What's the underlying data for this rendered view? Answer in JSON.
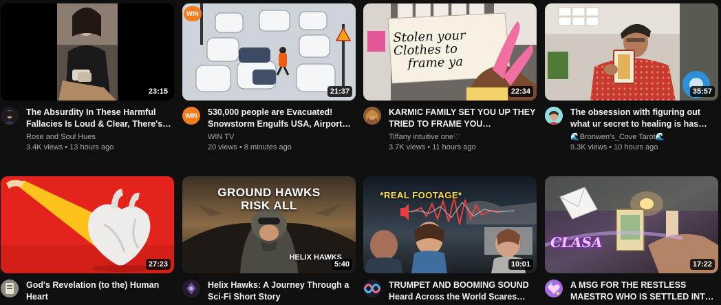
{
  "videos": [
    {
      "title": "The Absurdity In These Harmful Fallacies Is Loud & Clear, There's…",
      "channel": "Rose and Soul Hues",
      "views": "3.4K views",
      "age": "13 hours ago",
      "duration": "23:15"
    },
    {
      "title": "530,000 people are Evacuated! Snowstorm Engulfs USA, Airport…",
      "channel": "WIN TV",
      "views": "20 views",
      "age": "8 minutes ago",
      "duration": "21:37",
      "badge": "WIN",
      "avatar_text": "WIN"
    },
    {
      "title": "KARMIC FAMILY SET YOU UP THEY TRIED TO FRAME YOU…",
      "channel": "Tiffany intuitive one♡",
      "views": "3.7K views",
      "age": "11 hours ago",
      "duration": "22:34",
      "card_text": [
        "Stolen your",
        "Clothes to",
        "frame ya"
      ]
    },
    {
      "title": "The obsession with figuring out what ur secret to healing is has…",
      "channel": "🌊Bronwen's_Cove Tarot🌊",
      "views": "9.3K views",
      "age": "10 hours ago",
      "duration": "35:57"
    },
    {
      "title": "God's Revelation (to the) Human Heart",
      "duration": "27:23"
    },
    {
      "title": "Helix Hawks: A Journey Through a Sci-Fi Short Story",
      "duration": "5:40",
      "overlay_top": [
        "GROUND HAWKS",
        "RISK ALL"
      ],
      "overlay_bottom": "HELIX HAWKS"
    },
    {
      "title": "TRUMPET AND BOOMING SOUND Heard Across the World Scares…",
      "duration": "10:01",
      "overlay_top": "*REAL FOOTAGE*"
    },
    {
      "title": "A MSG FOR THE RESTLESS MAESTRO WHO IS SETTLED INT…",
      "duration": "17:22",
      "overlay_script": "CLASA"
    }
  ],
  "colors": {
    "background": "#0f0f0f",
    "title": "#f1f1f1",
    "secondary": "#aaaaaa",
    "win_orange": "#f47c20",
    "win_border": "#f4b400"
  }
}
